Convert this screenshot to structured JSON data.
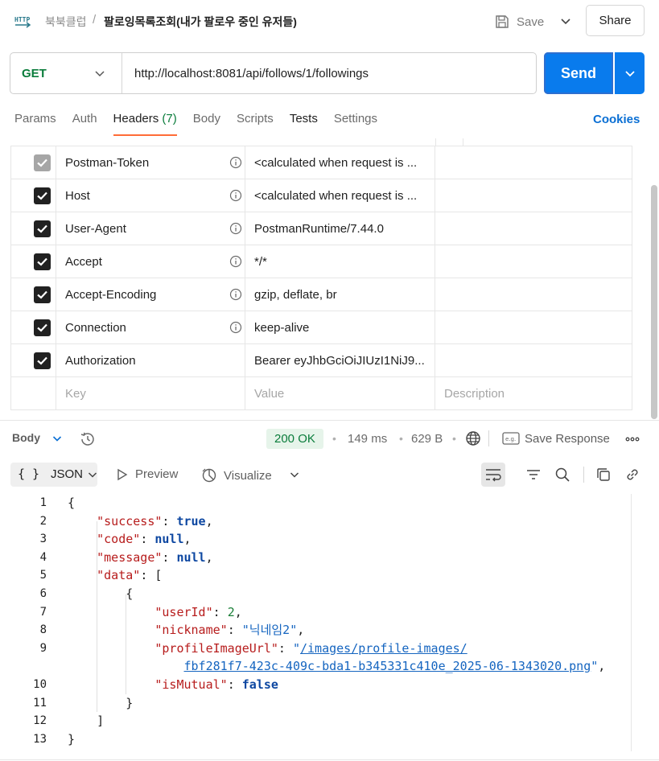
{
  "breadcrumb": {
    "parent": "북북클럽",
    "separator": "/",
    "title": "팔로잉목록조회(내가 팔로우 중인 유저들)"
  },
  "toolbar": {
    "save_label": "Save",
    "share_label": "Share"
  },
  "request": {
    "method": "GET",
    "url": "http://localhost:8081/api/follows/1/followings",
    "send_label": "Send"
  },
  "tabs": [
    {
      "label": "Params"
    },
    {
      "label": "Auth"
    },
    {
      "label": "Headers",
      "count": "(7)",
      "active": true
    },
    {
      "label": "Body"
    },
    {
      "label": "Scripts"
    },
    {
      "label": "Tests"
    },
    {
      "label": "Settings"
    }
  ],
  "cookies_label": "Cookies",
  "headers": [
    {
      "key": "Postman-Token",
      "value": "<calculated when request is ...",
      "checked": true,
      "disabled": true
    },
    {
      "key": "Host",
      "value": "<calculated when request is ...",
      "checked": true
    },
    {
      "key": "User-Agent",
      "value": "PostmanRuntime/7.44.0",
      "checked": true
    },
    {
      "key": "Accept",
      "value": "*/*",
      "checked": true
    },
    {
      "key": "Accept-Encoding",
      "value": "gzip, deflate, br",
      "checked": true
    },
    {
      "key": "Connection",
      "value": "keep-alive",
      "checked": true
    },
    {
      "key": "Authorization",
      "value": "Bearer eyJhbGciOiJIUzI1NiJ9...",
      "checked": true
    }
  ],
  "new_row": {
    "key_placeholder": "Key",
    "value_placeholder": "Value",
    "description_placeholder": "Description"
  },
  "response": {
    "body_label": "Body",
    "status": "200 OK",
    "time": "149 ms",
    "size": "629 B",
    "save_response_label": "Save Response",
    "format_label": "JSON",
    "format_braces": "{ }",
    "preview_label": "Preview",
    "visualize_label": "Visualize",
    "line_numbers": [
      "1",
      "2",
      "3",
      "4",
      "5",
      "6",
      "7",
      "8",
      "9",
      "",
      "10",
      "11",
      "12",
      "13"
    ]
  },
  "json_body": {
    "k_success": "\"success\"",
    "v_success": "true",
    "k_code": "\"code\"",
    "v_code": "null",
    "k_message": "\"message\"",
    "v_message": "null",
    "k_data": "\"data\"",
    "k_userId": "\"userId\"",
    "v_userId": "2",
    "k_nickname": "\"nickname\"",
    "v_nickname": "\"닉네임2\"",
    "k_profileImageUrl": "\"profileImageUrl\"",
    "v_profile_part1": "/images/profile-images/",
    "v_profile_part2": "fbf281f7-423c-409c-bda1-b345331c410e_2025-06-1343020.png",
    "k_isMutual": "\"isMutual\"",
    "v_isMutual": "false"
  },
  "colors": {
    "accent_orange": "#ff6c37",
    "send_blue": "#097bed",
    "method_green": "#0a7c3b",
    "link_blue": "#0a6fd4"
  }
}
